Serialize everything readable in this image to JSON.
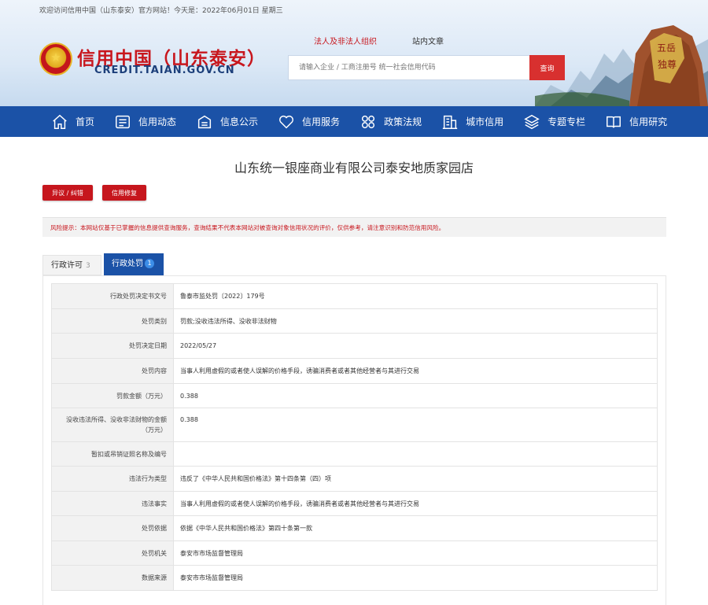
{
  "header": {
    "welcome": "欢迎访问信用中国（山东泰安）官方网站！今天是：2022年06月01日 星期三",
    "title": "信用中国（山东泰安）",
    "url": "CREDIT.TAIAN.GOV.CN",
    "search_tabs": [
      "法人及非法人组织",
      "站内文章"
    ],
    "search_placeholder": "请输入企业 / 工商注册号 统一社会信用代码",
    "search_button": "查询"
  },
  "nav": [
    {
      "label": "首页",
      "icon": "home-icon"
    },
    {
      "label": "信用动态",
      "icon": "news-icon"
    },
    {
      "label": "信息公示",
      "icon": "bulletin-icon"
    },
    {
      "label": "信用服务",
      "icon": "heart-icon"
    },
    {
      "label": "政策法规",
      "icon": "grid-icon"
    },
    {
      "label": "城市信用",
      "icon": "building-icon"
    },
    {
      "label": "专题专栏",
      "icon": "layers-icon"
    },
    {
      "label": "信用研究",
      "icon": "book-icon"
    }
  ],
  "company_name": "山东统一银座商业有限公司泰安地质家园店",
  "buttons": {
    "objection": "异议 / 纠错",
    "repair": "信用修复"
  },
  "risk_notice": "风险提示：本网站仅基于已掌握的信息提供查询服务，查询结果不代表本网站对被查询对象信用状况的评价，仅供参考，请注意识别和防范信用风险。",
  "tabs": {
    "license_label": "行政许可",
    "license_count": "3",
    "penalty_label": "行政处罚",
    "penalty_count": "1"
  },
  "penalty_rows": [
    {
      "key": "行政处罚决定书文号",
      "value": "鲁泰市监处罚〔2022〕179号"
    },
    {
      "key": "处罚类别",
      "value": "罚款;没收违法所得、没收非法财物"
    },
    {
      "key": "处罚决定日期",
      "value": "2022/05/27"
    },
    {
      "key": "处罚内容",
      "value": "当事人利用虚假的或者使人误解的价格手段，诱骗消费者或者其他经营者与其进行交易"
    },
    {
      "key": "罚款金额（万元）",
      "value": "0.388"
    },
    {
      "key": "没收违法所得、没收非法财物的金额（万元）",
      "value": "0.388"
    },
    {
      "key": "暂扣或吊销证照名称及编号",
      "value": ""
    },
    {
      "key": "违法行为类型",
      "value": "违反了《中华人民共和国价格法》第十四条第（四）项"
    },
    {
      "key": "违法事实",
      "value": "当事人利用虚假的或者使人误解的价格手段，诱骗消费者或者其他经营者与其进行交易"
    },
    {
      "key": "处罚依据",
      "value": "依据《中华人民共和国价格法》第四十条第一款"
    },
    {
      "key": "处罚机关",
      "value": "泰安市市场监督管理局"
    },
    {
      "key": "数据来源",
      "value": "泰安市市场监督管理局"
    }
  ],
  "colors": {
    "brand_red": "#c8161d",
    "nav_blue": "#1b52a7"
  }
}
